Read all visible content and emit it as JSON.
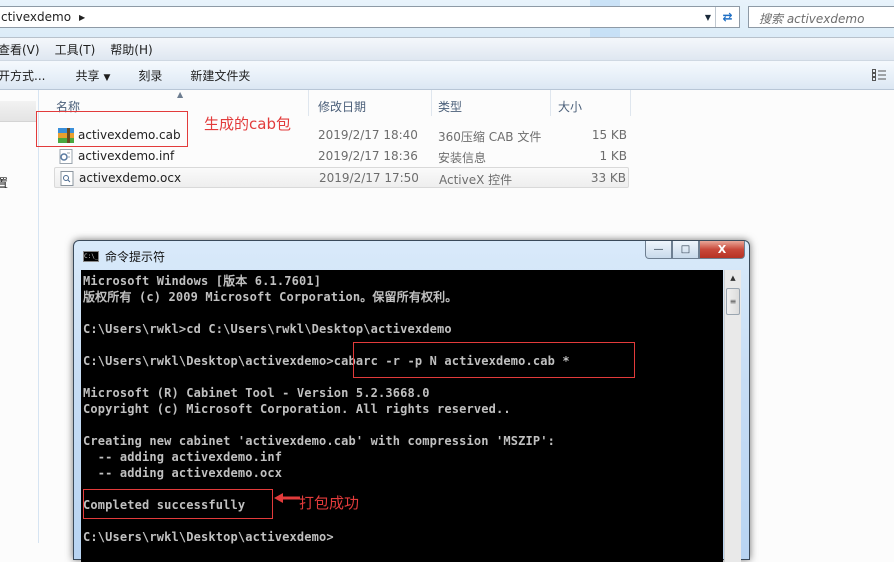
{
  "explorer": {
    "address": {
      "crumb": "ctivexdemo",
      "arrow": "▶",
      "dropdown": "▼",
      "refresh": "⇄"
    },
    "search": {
      "placeholder": "搜索 activexdemo"
    },
    "menu": [
      "查看(V)",
      "工具(T)",
      "帮助(H)"
    ],
    "commands": {
      "open_with": "开方式...",
      "share": "共享",
      "share_arrow": "▼",
      "burn": "刻录",
      "new_folder": "新建文件夹"
    },
    "nav": {
      "partial_label": "置"
    },
    "columns": {
      "name": "名称",
      "modified": "修改日期",
      "type": "类型",
      "size": "大小"
    },
    "files": [
      {
        "name": "activexdemo.cab",
        "modified": "2019/2/17 18:40",
        "type": "360压缩 CAB 文件",
        "size": "15 KB",
        "icon": "cab-archive-icon"
      },
      {
        "name": "activexdemo.inf",
        "modified": "2019/2/17 18:36",
        "type": "安装信息",
        "size": "1 KB",
        "icon": "inf-settings-icon"
      },
      {
        "name": "activexdemo.ocx",
        "modified": "2019/2/17 17:50",
        "type": "ActiveX 控件",
        "size": "33 KB",
        "icon": "ocx-control-icon"
      }
    ]
  },
  "annotations": {
    "cab_label": "生成的cab包",
    "success_label": "打包成功",
    "color": "#e23b3b"
  },
  "cmd": {
    "title": "命令提示符",
    "icon_text": "C:\\_",
    "buttons": {
      "minimize": "—",
      "maximize": "□",
      "close": "X"
    },
    "lines": [
      "Microsoft Windows [版本 6.1.7601]",
      "版权所有 (c) 2009 Microsoft Corporation。保留所有权利。",
      "",
      "C:\\Users\\rwkl>cd C:\\Users\\rwkl\\Desktop\\activexdemo",
      "",
      "C:\\Users\\rwkl\\Desktop\\activexdemo>cabarc -r -p N activexdemo.cab *",
      "",
      "Microsoft (R) Cabinet Tool - Version 5.2.3668.0",
      "Copyright (c) Microsoft Corporation. All rights reserved..",
      "",
      "Creating new cabinet 'activexdemo.cab' with compression 'MSZIP':",
      "  -- adding activexdemo.inf",
      "  -- adding activexdemo.ocx",
      "",
      "Completed successfully",
      "",
      "C:\\Users\\rwkl\\Desktop\\activexdemo>"
    ]
  }
}
